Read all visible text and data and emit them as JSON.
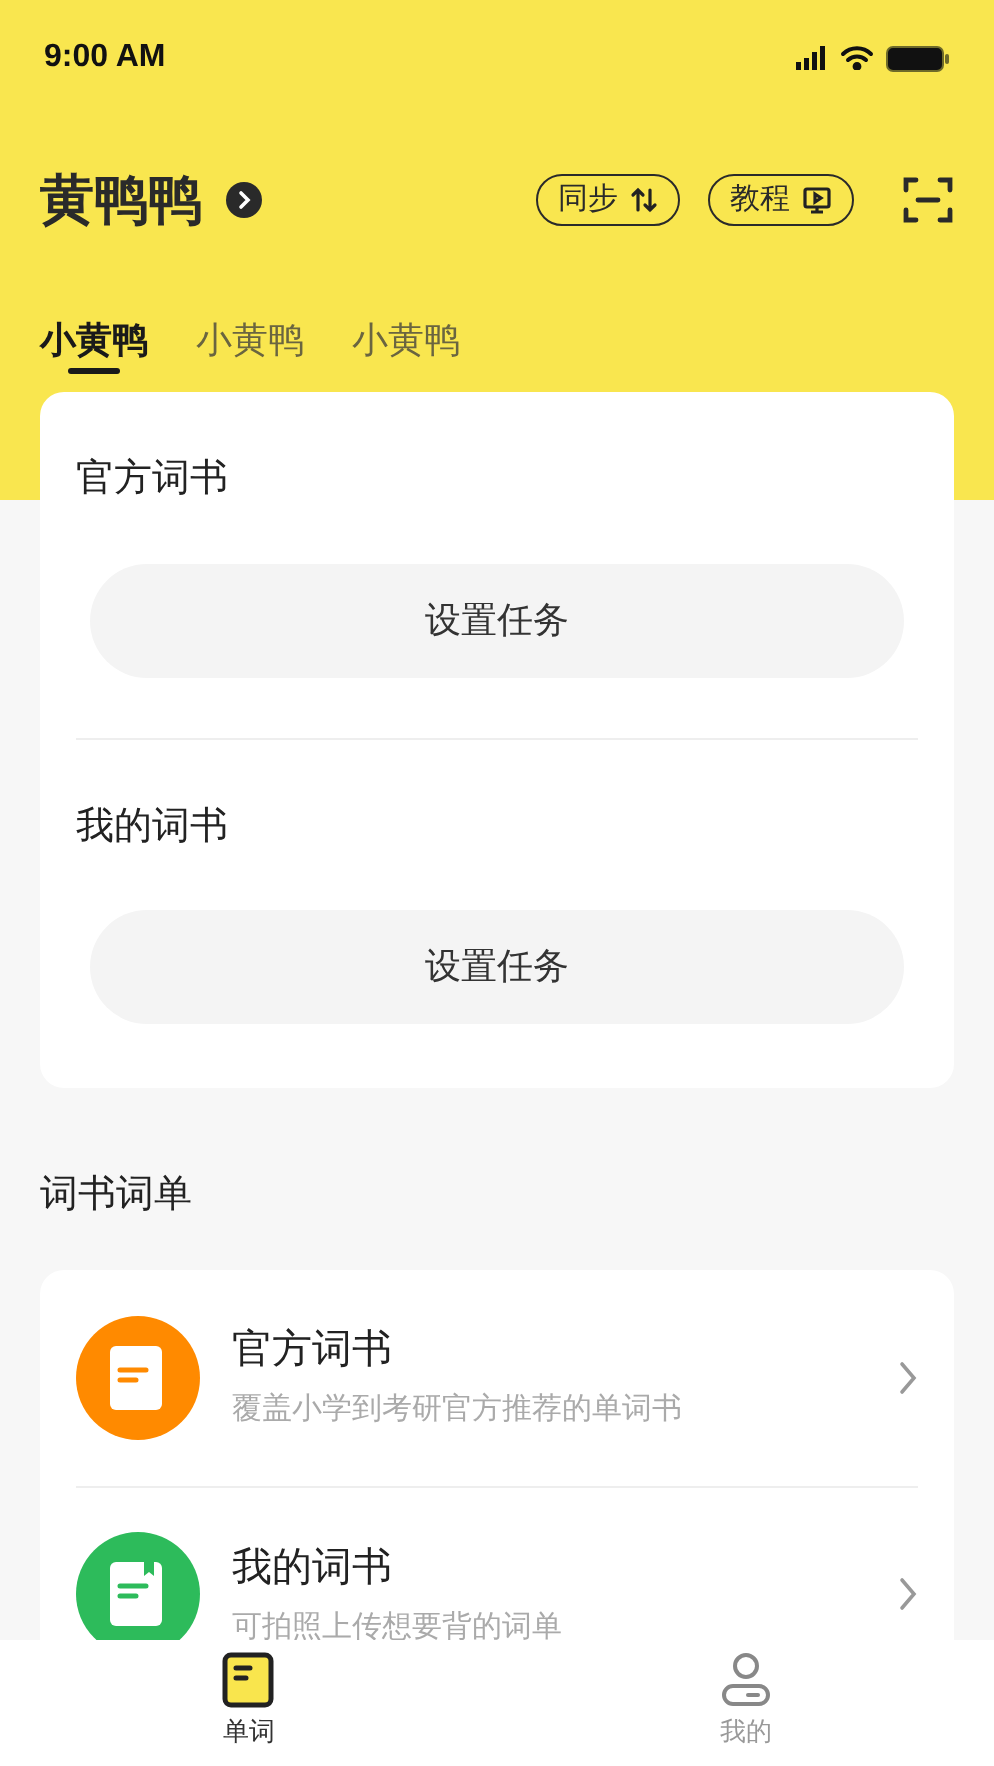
{
  "status_bar": {
    "time": "9:00 AM"
  },
  "header": {
    "title": "黄鸭鸭",
    "actions": [
      {
        "kind": "sync",
        "label": "同步"
      },
      {
        "kind": "tutorial",
        "label": "教程"
      }
    ]
  },
  "tabs": [
    {
      "label": "小黄鸭",
      "selected": true
    },
    {
      "label": "小黄鸭",
      "selected": false
    },
    {
      "label": "小黄鸭",
      "selected": false
    }
  ],
  "task_card": {
    "sections": [
      {
        "title": "官方词书",
        "button": "设置任务"
      },
      {
        "title": "我的词书",
        "button": "设置任务"
      }
    ]
  },
  "book_list": {
    "heading": "词书词单",
    "items": [
      {
        "title": "官方词书",
        "subtitle": "覆盖小学到考研官方推荐的单词书",
        "color": "#ff8a00"
      },
      {
        "title": "我的词书",
        "subtitle": "可拍照上传想要背的词单",
        "color": "#2dbb5b"
      }
    ]
  },
  "bottom_nav": [
    {
      "kind": "words",
      "label": "单词",
      "selected": true
    },
    {
      "kind": "me",
      "label": "我的",
      "selected": false
    }
  ]
}
